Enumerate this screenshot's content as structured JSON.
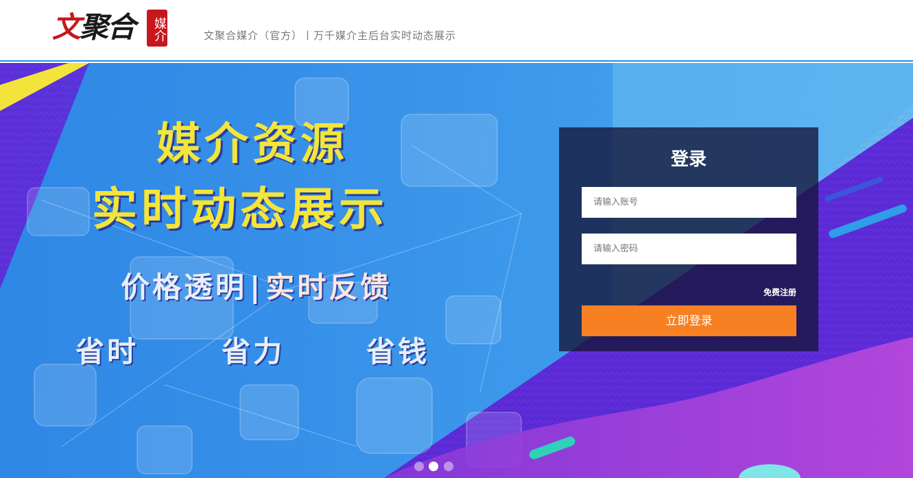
{
  "header": {
    "logo_text_red": "文",
    "logo_text_dark": "聚合",
    "logo_seal": "媒介",
    "tagline": "文聚合媒介（官方）丨万千媒介主后台实时动态展示"
  },
  "banner": {
    "slogan_line1": "媒介资源",
    "slogan_line2": "实时动态展示",
    "feature_left": "价格透明",
    "feature_separator": "|",
    "feature_right": "实时反馈",
    "benefits": [
      "省时",
      "省力",
      "省钱"
    ],
    "carousel": {
      "slide_count": 3,
      "active_index": 2
    }
  },
  "login": {
    "title": "登录",
    "account_placeholder": "请输入账号",
    "password_placeholder": "请输入密码",
    "register_link": "免费注册",
    "submit_label": "立即登录"
  },
  "colors": {
    "header_border": "#1f8ee6",
    "brand_red": "#c8161d",
    "slogan_yellow": "#f3e53a",
    "login_button": "#f78022",
    "login_panel": "rgba(20,20,55,0.78)"
  }
}
